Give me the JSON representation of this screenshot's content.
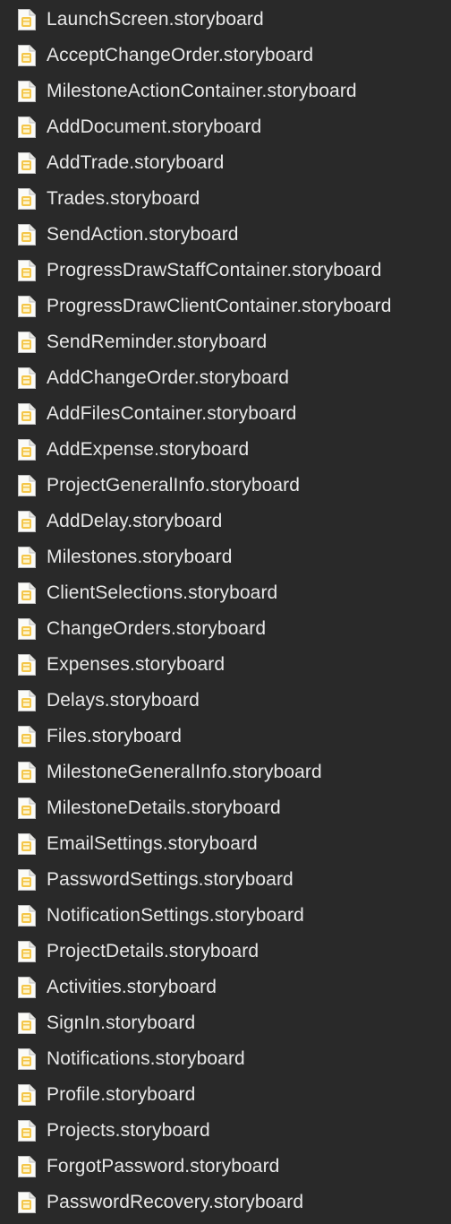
{
  "icon": "storyboard-file-icon",
  "files": [
    "LaunchScreen.storyboard",
    "AcceptChangeOrder.storyboard",
    "MilestoneActionContainer.storyboard",
    "AddDocument.storyboard",
    "AddTrade.storyboard",
    "Trades.storyboard",
    "SendAction.storyboard",
    "ProgressDrawStaffContainer.storyboard",
    "ProgressDrawClientContainer.storyboard",
    "SendReminder.storyboard",
    "AddChangeOrder.storyboard",
    "AddFilesContainer.storyboard",
    "AddExpense.storyboard",
    "ProjectGeneralInfo.storyboard",
    "AddDelay.storyboard",
    "Milestones.storyboard",
    "ClientSelections.storyboard",
    "ChangeOrders.storyboard",
    "Expenses.storyboard",
    "Delays.storyboard",
    "Files.storyboard",
    "MilestoneGeneralInfo.storyboard",
    "MilestoneDetails.storyboard",
    "EmailSettings.storyboard",
    "PasswordSettings.storyboard",
    "NotificationSettings.storyboard",
    "ProjectDetails.storyboard",
    "Activities.storyboard",
    "SignIn.storyboard",
    "Notifications.storyboard",
    "Profile.storyboard",
    "Projects.storyboard",
    "ForgotPassword.storyboard",
    "PasswordRecovery.storyboard"
  ]
}
